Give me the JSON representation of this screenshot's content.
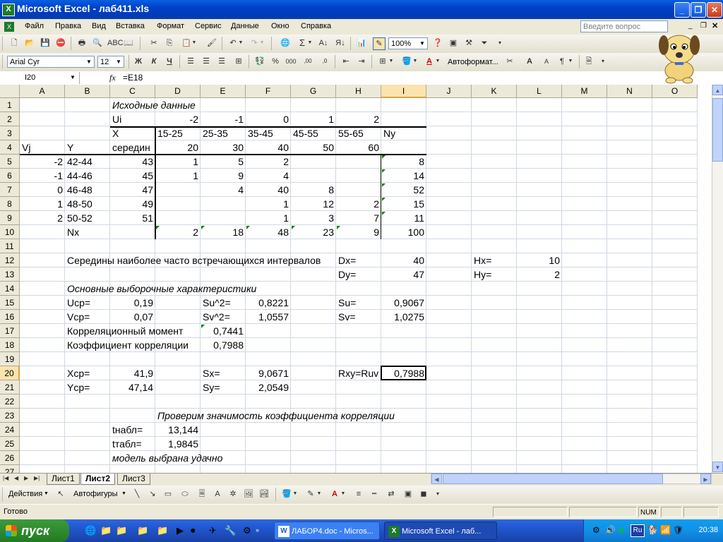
{
  "window": {
    "title": "Microsoft Excel - лаб411.xls"
  },
  "menu": {
    "items": [
      "Файл",
      "Правка",
      "Вид",
      "Вставка",
      "Формат",
      "Сервис",
      "Данные",
      "Окно",
      "Справка"
    ],
    "help_placeholder": "Введите вопрос"
  },
  "standard_toolbar": {
    "zoom": "100%"
  },
  "formatting_toolbar": {
    "font": "Arial Cyr",
    "size": "12",
    "bold": "Ж",
    "italic": "К",
    "underline": "Ч",
    "autoformat": "Автоформат..."
  },
  "formula_bar": {
    "name_box": "I20",
    "fx": "fx",
    "formula": "=E18"
  },
  "columns": [
    "A",
    "B",
    "C",
    "D",
    "E",
    "F",
    "G",
    "H",
    "I",
    "J",
    "K",
    "L",
    "M",
    "N",
    "O"
  ],
  "rows": [
    "1",
    "2",
    "3",
    "4",
    "5",
    "6",
    "7",
    "8",
    "9",
    "10",
    "11",
    "12",
    "13",
    "14",
    "15",
    "16",
    "17",
    "18",
    "19",
    "20",
    "21",
    "22",
    "23",
    "24",
    "25",
    "26",
    "27"
  ],
  "cells": {
    "C1": "Исходные данные",
    "C2": "Ui",
    "D2": "-2",
    "E2": "-1",
    "F2": "0",
    "G2": "1",
    "H2": "2",
    "C3": "X",
    "D3": "15-25",
    "E3": "25-35",
    "F3": "35-45",
    "G3": "45-55",
    "H3": "55-65",
    "I3": "Ny",
    "A4": "Vj",
    "B4": "Y",
    "C4": "середин",
    "D4": "20",
    "E4": "30",
    "F4": "40",
    "G4": "50",
    "H4": "60",
    "A5": "-2",
    "B5": "42-44",
    "C5": "43",
    "D5": "1",
    "E5": "5",
    "F5": "2",
    "I5": "8",
    "A6": "-1",
    "B6": "44-46",
    "C6": "45",
    "D6": "1",
    "E6": "9",
    "F6": "4",
    "I6": "14",
    "A7": "0",
    "B7": "46-48",
    "C7": "47",
    "E7": "4",
    "F7": "40",
    "G7": "8",
    "I7": "52",
    "A8": "1",
    "B8": "48-50",
    "C8": "49",
    "F8": "1",
    "G8": "12",
    "H8": "2",
    "I8": "15",
    "A9": "2",
    "B9": "50-52",
    "C9": "51",
    "F9": "1",
    "G9": "3",
    "H9": "7",
    "I9": "11",
    "B10": "Nx",
    "D10": "2",
    "E10": "18",
    "F10": "48",
    "G10": "23",
    "H10": "9",
    "I10": "100",
    "B12": "Середины наиболее часто встречающихся интервалов",
    "H12": "Dx=",
    "I12": "40",
    "K12": "Hx=",
    "L12": "10",
    "H13": "Dy=",
    "I13": "47",
    "K13": "Hy=",
    "L13": "2",
    "B14": "Основные выборочные характеристики",
    "B15": "Ucp=",
    "C15": "0,19",
    "E15": "Su^2=",
    "F15": "0,8221",
    "H15": "Su=",
    "I15": "0,9067",
    "B16": "Vcp=",
    "C16": "0,07",
    "E16": "Sv^2=",
    "F16": "1,0557",
    "H16": "Sv=",
    "I16": "1,0275",
    "B17": "Корреляционный момент",
    "E17": "0,7441",
    "B18": "Коэффициент корреляции",
    "E18": "0,7988",
    "B20": "Xcp=",
    "C20": "41,9",
    "E20": "Sx=",
    "F20": "9,0671",
    "H20": "Rxy=Ruv",
    "I20": "0,7988",
    "B21": "Ycp=",
    "C21": "47,14",
    "E21": "Sy=",
    "F21": "2,0549",
    "D23": "Проверим значимость коэффициента корреляции",
    "C24": "tнабл=",
    "D24": "13,144",
    "C25": "tтабл=",
    "D25": "1,9845",
    "C26": "модель выбрана удачно"
  },
  "sheet_tabs": [
    "Лист1",
    "Лист2",
    "Лист3"
  ],
  "active_sheet": "Лист2",
  "drawing_toolbar": {
    "actions": "Действия",
    "autoshapes": "Автофигуры"
  },
  "status": {
    "text": "Готово",
    "num": "NUM"
  },
  "taskbar": {
    "start": "пуск",
    "tasks": [
      "ЛАБОР4.doc - Micros...",
      "Microsoft Excel - лаб..."
    ],
    "lang": "Ru",
    "clock": "20:38"
  }
}
